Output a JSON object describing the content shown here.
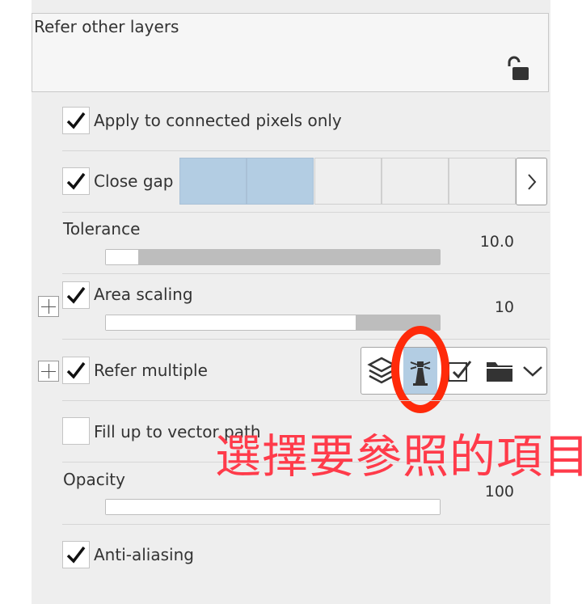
{
  "refer_other_layers": {
    "title": "Refer other layers",
    "lock_icon": "unlocked-padlock-icon"
  },
  "options": {
    "connected_pixels": {
      "label": "Apply to connected pixels only",
      "checked": true
    },
    "close_gap": {
      "label": "Close gap",
      "checked": true,
      "selected_levels": 2,
      "total_levels": 5
    },
    "tolerance": {
      "label": "Tolerance",
      "value": "10.0",
      "fraction": 0.1
    },
    "area_scaling": {
      "label": "Area scaling",
      "value": "10",
      "fraction": 0.75,
      "checked": true
    },
    "refer_multiple": {
      "label": "Refer multiple",
      "checked": true,
      "icons": [
        "layers-stack-icon",
        "lighthouse-icon",
        "checkbox-icon",
        "folder-icon",
        "chevron-down-icon"
      ],
      "selected_icon": "lighthouse-icon"
    },
    "fill_vector": {
      "label": "Fill up to vector path",
      "checked": false
    },
    "opacity": {
      "label": "Opacity",
      "value": "100",
      "fraction": 1.0
    },
    "anti_aliasing": {
      "label": "Anti-aliasing",
      "checked": true
    }
  },
  "annotation": {
    "text": "選擇要參照的項目",
    "color": "#ff3b4a"
  }
}
